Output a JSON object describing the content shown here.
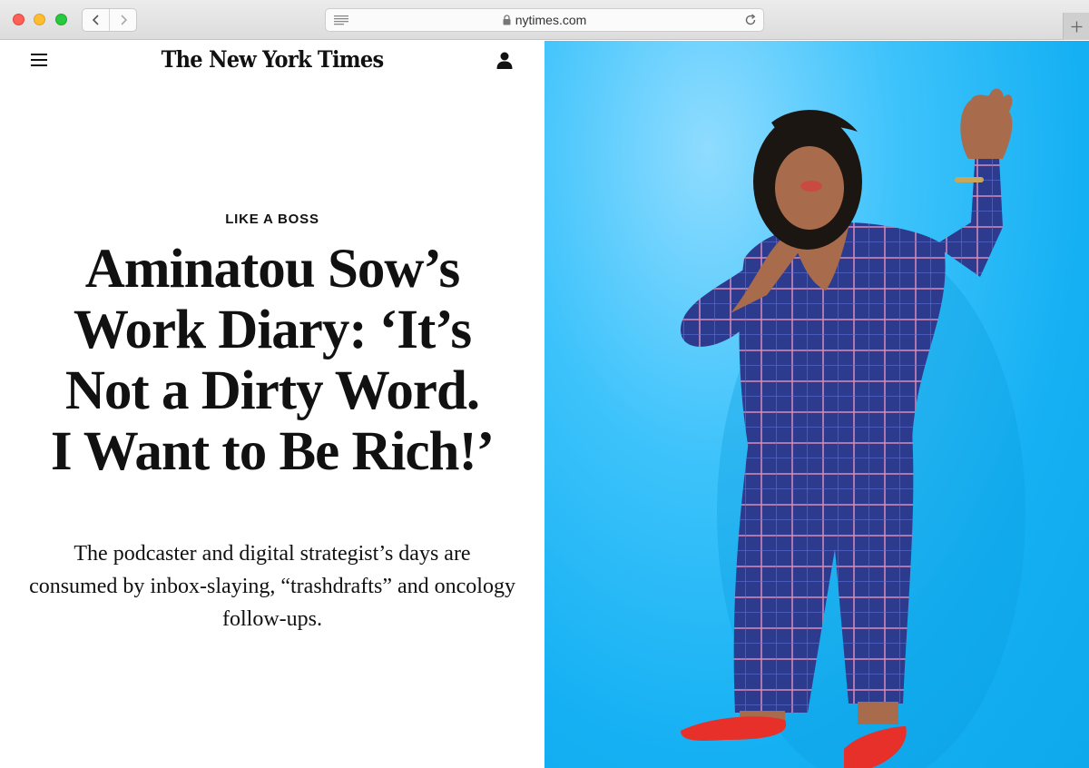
{
  "browser": {
    "url": "nytimes.com"
  },
  "site": {
    "masthead": "The New York Times"
  },
  "article": {
    "kicker": "LIKE A BOSS",
    "headline_lines": [
      "Aminatou Sow’s",
      "Work Diary: ‘It’s",
      "Not a Dirty Word.",
      "I Want to Be Rich!’"
    ],
    "dek": "The podcaster and digital strategist’s days are consumed by inbox-slaying, “trashdrafts” and oncology follow-ups."
  },
  "colors": {
    "photo_background": "#14b0f3",
    "suit": "#2c3c8c",
    "shoes": "#e8302a"
  },
  "icons": {
    "menu": "hamburger-icon",
    "account": "user-icon",
    "back": "chevron-left-icon",
    "forward": "chevron-right-icon",
    "reader": "reader-icon",
    "lock": "lock-icon",
    "reload": "reload-icon",
    "new_tab": "plus-icon"
  }
}
